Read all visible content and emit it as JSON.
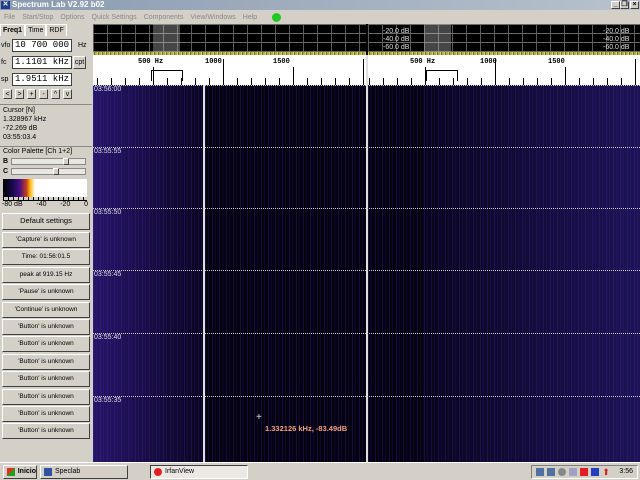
{
  "window": {
    "title": "Spectrum Lab V2.92 b02",
    "minimize": "_",
    "restore": "❐",
    "close": "×"
  },
  "menu": [
    "File",
    "Start/Stop",
    "Options",
    "Quick Settings",
    "Components",
    "View/Windows",
    "Help"
  ],
  "left": {
    "tabs": [
      "Freq1",
      "Time",
      "RDF"
    ],
    "vfo": {
      "label": "vfo",
      "value": "10 700 000",
      "unit": "Hz"
    },
    "fc": {
      "label": "fc",
      "value": "1.1101 kHz",
      "button": "cpt"
    },
    "sp": {
      "label": "sp",
      "value": "1.9511 kHz"
    },
    "steps": [
      "<",
      ">",
      "+",
      "-",
      "^",
      "v"
    ],
    "cursor": {
      "title": "Cursor [N]",
      "freq": "1.328967 kHz",
      "level": "-72.269 dB",
      "time": "03:55:03.4"
    },
    "palette": {
      "title": "Color Palette [Ch 1+2]",
      "b_label": "B",
      "c_label": "C",
      "b_value": 0.75,
      "c_value": 0.6,
      "scale": [
        "-80 dB",
        "-40",
        "-20",
        "0"
      ]
    },
    "buttons": [
      "Default settings",
      "'Capture' is unknown",
      "Time:  01:56:01.5",
      "peak at 919.15 Hz",
      "'Pause' is unknown",
      "'Continue' is unknown",
      "'Button' is unknown",
      "'Button' is unknown",
      "'Button' is unknown",
      "'Button' is unknown",
      "'Button' is unknown",
      "'Button' is unknown",
      "'Button' is unknown"
    ]
  },
  "spectrum": {
    "db_labels": [
      "-20.0 dB",
      "-40.0 dB",
      "-60.0 dB"
    ],
    "freq_labels_left": [
      "500 Hz",
      "1000",
      "1500"
    ],
    "freq_labels_right": [
      "500 Hz",
      "1000",
      "1500"
    ],
    "time_labels": [
      "03:56:00",
      "03:55:55",
      "03:55:50",
      "03:55:45",
      "03:55:40",
      "03:55:35"
    ],
    "cursor_readout": "1.332126 kHz, -83.49dB"
  },
  "taskbar": {
    "start": "Inicio",
    "items": [
      "Speclab",
      "IrfanView"
    ],
    "clock": "3:56"
  }
}
